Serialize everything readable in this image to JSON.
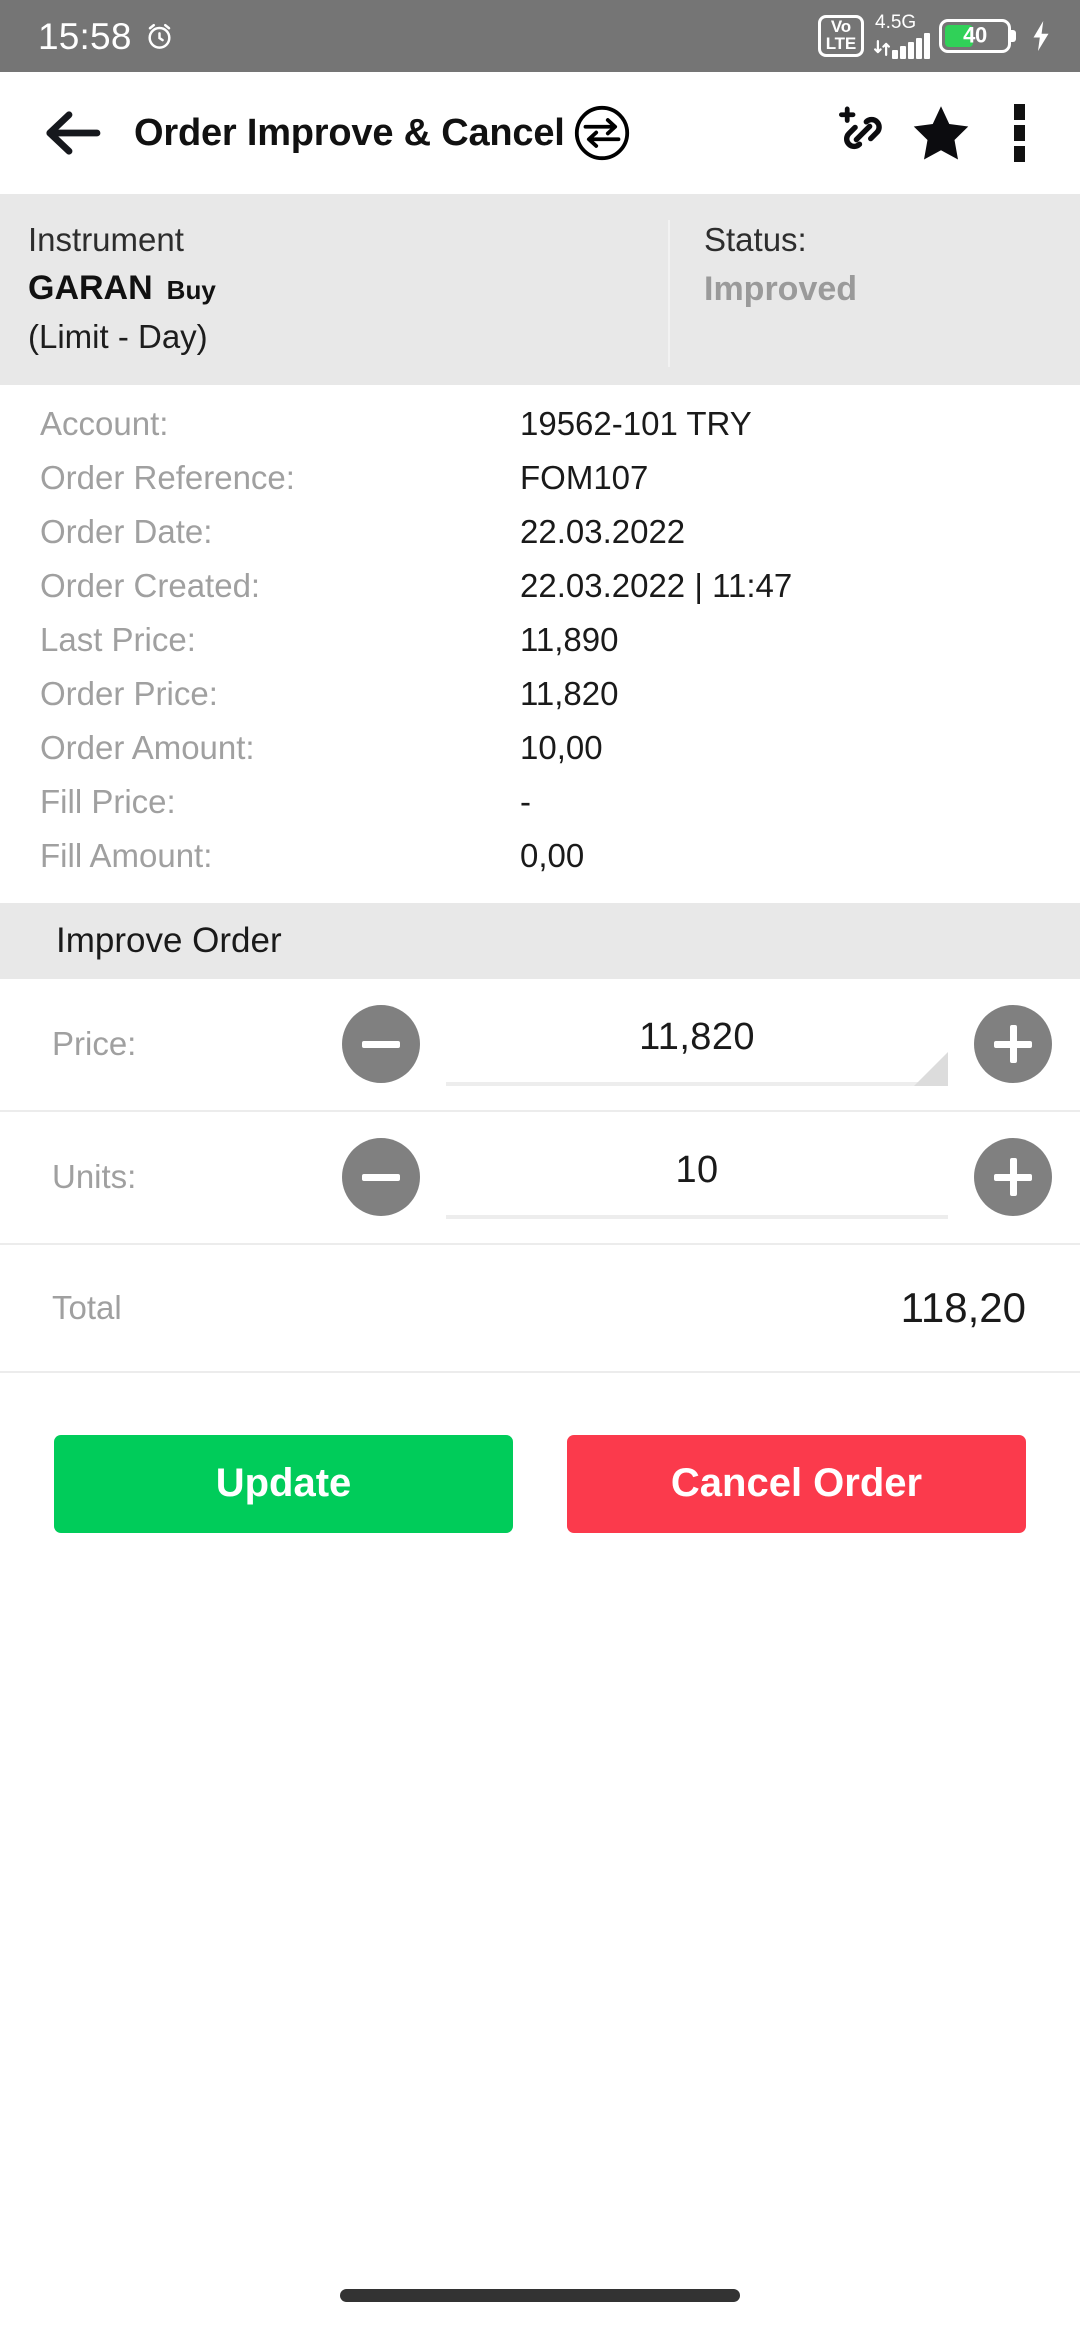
{
  "status_bar": {
    "time": "15:58",
    "alarm_icon": "alarm-clock-icon",
    "volte_top": "Vo",
    "volte_bottom": "LTE",
    "network_type": "4.5G",
    "battery_percent": "40",
    "charging_icon": "charging-bolt-icon",
    "background_color": "#757575"
  },
  "app_bar": {
    "back_icon": "back-arrow-icon",
    "title": "Order Improve & Cancel",
    "swap_icon": "swap-circle-icon",
    "add_link_icon": "add-link-icon",
    "favorite_icon": "star-icon",
    "more_icon": "more-vertical-icon"
  },
  "info_band": {
    "instrument_label": "Instrument",
    "instrument_symbol": "GARAN",
    "instrument_side": "Buy",
    "instrument_type": "(Limit - Day)",
    "status_label": "Status:",
    "status_value": "Improved",
    "background_color": "#E8E8E8"
  },
  "details": [
    {
      "label": "Account:",
      "value": "19562-101 TRY"
    },
    {
      "label": "Order Reference:",
      "value": "FOM107"
    },
    {
      "label": "Order Date:",
      "value": "22.03.2022"
    },
    {
      "label": "Order Created:",
      "value": "22.03.2022 | 11:47"
    },
    {
      "label": "Last Price:",
      "value": "11,890"
    },
    {
      "label": "Order Price:",
      "value": "11,820"
    },
    {
      "label": "Order Amount:",
      "value": "10,00"
    },
    {
      "label": "Fill Price:",
      "value": "-"
    },
    {
      "label": "Fill Amount:",
      "value": "0,00"
    }
  ],
  "improve_order": {
    "section_title": "Improve Order",
    "price": {
      "label": "Price:",
      "value": "11,820",
      "decrement_icon": "minus-circle-icon",
      "increment_icon": "plus-circle-icon",
      "has_resize_handle": true
    },
    "units": {
      "label": "Units:",
      "value": "10",
      "decrement_icon": "minus-circle-icon",
      "increment_icon": "plus-circle-icon",
      "has_resize_handle": false
    },
    "total": {
      "label": "Total",
      "value": "118,20"
    }
  },
  "actions": {
    "update_label": "Update",
    "update_color": "#00CC5A",
    "cancel_label": "Cancel Order",
    "cancel_color": "#FB3A4C"
  }
}
